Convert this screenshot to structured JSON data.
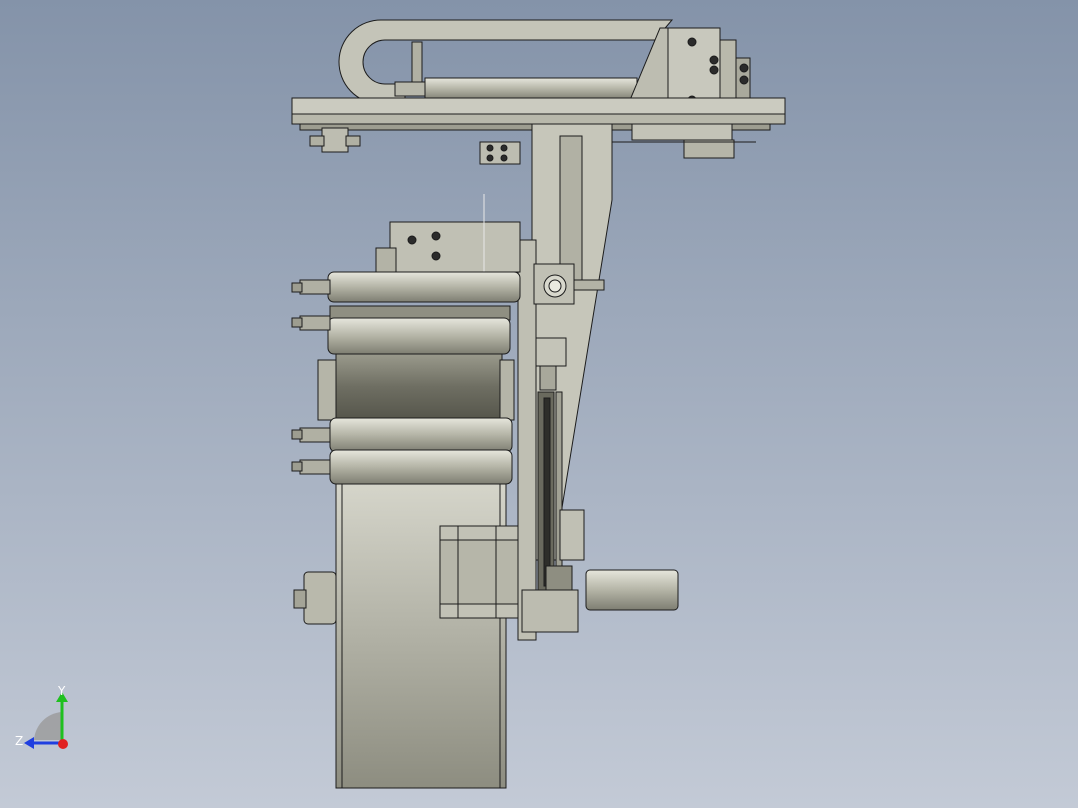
{
  "viewport": {
    "background_top": "#8493a9",
    "background_bottom": "#c3cad6"
  },
  "model": {
    "part_fill": "#c8c8bd",
    "part_dark": "#a9a99c",
    "edge_color": "#1c1c1c",
    "roller_fill": "#bdbdb0",
    "drum_fill": "#cfcfc3"
  },
  "triad": {
    "y_label": "Y",
    "z_label": "Z",
    "y_color": "#1fc01f",
    "z_color": "#1f3fe0",
    "x_color": "#e02020"
  }
}
